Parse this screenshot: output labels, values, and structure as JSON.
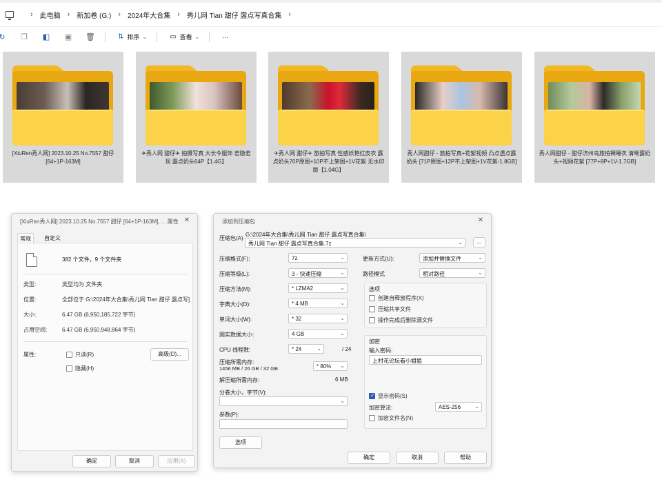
{
  "breadcrumb": [
    "此电脑",
    "新加卷 (G:)",
    "2024年大合集",
    "秀儿网 Tian 甜仔 露点写真合集"
  ],
  "toolbar": {
    "sort_label": "排序",
    "view_label": "查看",
    "more_label": "···"
  },
  "folders": [
    {
      "caption": "[XiuRen秀人网] 2023.10.25 No.7557 甜仔 [64+1P-163M]"
    },
    {
      "caption": "✈秀人网 甜仔✈ 拍摄写真 大长今服饰 若隐若现 露点奶头64P【1.4G】"
    },
    {
      "caption": "✈秀人网 甜仔✈ 旅拍写真 性感妖艳红皮衣 露点奶头70P原图+10P不上架图+1V花絮 无水印版【1.04G】"
    },
    {
      "caption": "秀人网甜仔 - 旅拍写真+花絮视频 凸点透点露奶头 [71P原图+12P不上架图+1V花絮-1.8GB]"
    },
    {
      "caption": "秀人网甜仔 - 甜仔济州岛旅拍裸睡衣 清晰露奶头+视频花絮 [77P+8P+1V-1.7GB]"
    }
  ],
  "properties_dialog": {
    "title": "[XiuRen秀人网] 2023.10.25 No.7557 甜仔 [64+1P-163M], ... 属性",
    "close": "✕",
    "tabs": [
      "常规",
      "自定义"
    ],
    "summary": "382 个文件，9 个文件夹",
    "rows": [
      {
        "key": "类型:",
        "value": "类型均为 文件夹"
      },
      {
        "key": "位置:",
        "value": "全部位于 G:\\2024年大合集\\秀儿网 Tian 甜仔 露点写]"
      },
      {
        "key": "大小:",
        "value": "6.47 GB (6,950,185,722 字节)"
      },
      {
        "key": "占用空间:",
        "value": "6.47 GB (6,950,948,864 字节)"
      }
    ],
    "attributes_label": "属性:",
    "readonly_label": "只读(R)",
    "hidden_label": "隐藏(H)",
    "advanced_button": "高级(D)...",
    "ok": "确定",
    "cancel": "取消",
    "apply": "应用(A)"
  },
  "archive_dialog": {
    "title": "添加到压缩包",
    "close": "✕",
    "archive_label": "压缩包(A)",
    "archive_path": "G:\\2024年大合集\\秀儿网 Tian 甜仔 露点写真合集\\",
    "archive_name": "秀儿网 Tian 甜仔 露点写真合集.7z",
    "browse": "...",
    "format_label": "压缩格式(F):",
    "format_value": "7z",
    "level_label": "压缩等级(L):",
    "level_value": "3 - 快速压缩",
    "method_label": "压缩方法(M):",
    "method_value": "* LZMA2",
    "dict_label": "字典大小(D):",
    "dict_value": "* 4 MB",
    "word_label": "单词大小(W):",
    "word_value": "* 32",
    "solid_label": "固实数据大小:",
    "solid_value": "4 GB",
    "cpu_label": "CPU 线程数:",
    "cpu_value": "* 24",
    "cpu_total": "/ 24",
    "mem_label": "压缩所需内存:",
    "mem_detail": "1456 MB / 26 GB / 32 GB",
    "mem_value": "* 80%",
    "decomp_label": "解压缩所需内存:",
    "decomp_value": "6 MB",
    "split_label": "分卷大小，字节(V):",
    "params_label": "参数(P):",
    "options_button": "选项",
    "update_label": "更新方式(U):",
    "update_value": "添加并替换文件",
    "path_label": "路径模式",
    "path_value": "相对路径",
    "opts_title": "选项",
    "opt_sfx": "创建自释放程序(X)",
    "opt_shared": "压缩共享文件",
    "opt_delete": "操作完成后删除源文件",
    "enc_title": "加密",
    "pwd_label": "输入密码:",
    "pwd_value": "上村花论坛看小姐姐",
    "show_pwd": "显示密码(S)",
    "enc_method_label": "加密算法:",
    "enc_method_value": "AES-256",
    "enc_names": "加密文件名(N)",
    "ok": "确定",
    "cancel": "取消",
    "help": "帮助"
  }
}
